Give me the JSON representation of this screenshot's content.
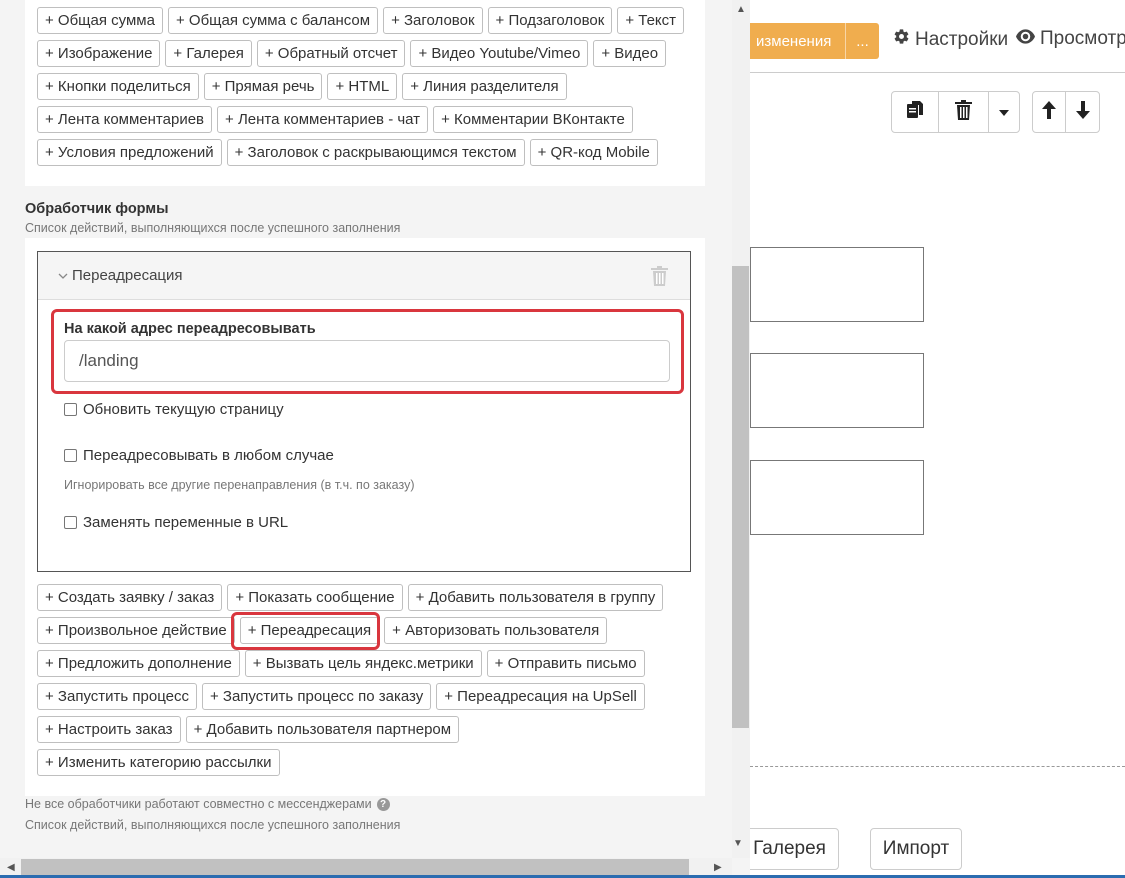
{
  "topbar": {
    "save_label": "изменения",
    "save_more": "...",
    "settings_label": "Настройки",
    "preview_label": "Просмотр"
  },
  "blocks": {
    "rows": [
      [
        "+ Общая сумма",
        "+ Общая сумма с балансом",
        "+ Заголовок",
        "+ Подзаголовок",
        "+ Текст"
      ],
      [
        "+ Изображение",
        "+ Галерея",
        "+ Обратный отсчет",
        "+ Видео Youtube/Vimeo",
        "+ Видео"
      ],
      [
        "+ Кнопки поделиться",
        "+ Прямая речь",
        "+ HTML",
        "+ Линия разделителя"
      ],
      [
        "+ Лента комментариев",
        "+ Лента комментариев - чат",
        "+ Комментарии ВКонтакте"
      ],
      [
        "+ Условия предложений",
        "+ Заголовок с раскрывающимся текстом",
        "+ QR-код Mobile"
      ]
    ]
  },
  "handler": {
    "title": "Обработчик формы",
    "subtitle": "Список действий, выполняющихся после успешного заполнения"
  },
  "redirect": {
    "title": "Переадресация",
    "address_label": "На какой адрес переадресовывать",
    "address_value": "/landing",
    "refresh_label": "Обновить текущую страницу",
    "always_label": "Переадресовывать в любом случае",
    "always_hint": "Игнорировать все другие перенаправления (в т.ч. по заказу)",
    "replace_vars_label": "Заменять переменные в URL"
  },
  "actions": {
    "rows": [
      [
        "+ Создать заявку / заказ",
        "+ Показать сообщение",
        "+ Добавить пользователя в группу"
      ],
      [
        "+ Произвольное действие",
        "+ Переадресация",
        "+ Авторизовать пользователя"
      ],
      [
        "+ Предложить дополнение",
        "+ Вызвать цель яндекс.метрики",
        "+ Отправить письмо"
      ],
      [
        "+ Запустить процесс",
        "+ Запустить процесс по заказу",
        "+ Переадресация на UpSell"
      ],
      [
        "+ Настроить заказ",
        "+ Добавить пользователя партнером"
      ],
      [
        "+ Изменить категорию рассылки"
      ]
    ]
  },
  "footer": {
    "messenger_note": "Не все обработчики работают совместно с мессенджерами",
    "subtitle": "Список действий, выполняющихся после успешного заполнения"
  },
  "bottom_buttons": {
    "gallery": "Галерея",
    "import": "Импорт"
  },
  "colors": {
    "accent_orange": "#f0ad4e",
    "highlight_red": "#d9363e"
  }
}
